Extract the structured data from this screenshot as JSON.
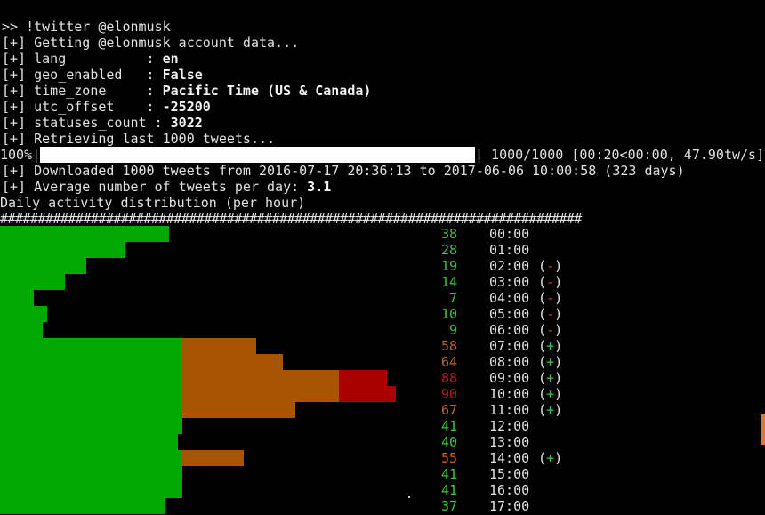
{
  "lines": [
    ">> !twitter @elonmusk",
    "[+] Getting @elonmusk account data..."
  ],
  "fields": [
    {
      "prefix": "[+] lang          : ",
      "value": "en"
    },
    {
      "prefix": "[+] geo_enabled   : ",
      "value": "False"
    },
    {
      "prefix": "[+] time_zone     : ",
      "value": "Pacific Time (US & Canada)"
    },
    {
      "prefix": "[+] utc_offset    : ",
      "value": "-25200"
    },
    {
      "prefix": "[+] statuses_count : ",
      "value": "3022"
    }
  ],
  "retrieving": "[+] Retrieving last 1000 tweets...",
  "progress": {
    "percent_text": "100%|",
    "fraction": 1.0,
    "suffix": "| 1000/1000 [00:20<00:00, 47.90tw/s]"
  },
  "downloaded": "[+] Downloaded 1000 tweets from 2016-07-17 20:36:13 to 2017-06-06 10:00:58 (323 days)",
  "average": {
    "prefix": "[+] Average number of tweets per day: ",
    "value": "3.1"
  },
  "dist_title": "Daily activity distribution (per hour)",
  "separator": "#############################################################################",
  "colors": {
    "green": "#00a800",
    "orange": "#a85400",
    "red": "#a80000",
    "bright_green": "#3fc43f"
  },
  "activity": [
    {
      "count": "38",
      "hour": "00:00",
      "mark": "",
      "level": "green"
    },
    {
      "count": "28",
      "hour": "01:00",
      "mark": "",
      "level": "green"
    },
    {
      "count": "19",
      "hour": "02:00",
      "mark": "-",
      "level": "green"
    },
    {
      "count": "14",
      "hour": "03:00",
      "mark": "-",
      "level": "green"
    },
    {
      "count": "7",
      "hour": "04:00",
      "mark": "-",
      "level": "green"
    },
    {
      "count": "10",
      "hour": "05:00",
      "mark": "-",
      "level": "green"
    },
    {
      "count": "9",
      "hour": "06:00",
      "mark": "-",
      "level": "green"
    },
    {
      "count": "58",
      "hour": "07:00",
      "mark": "+",
      "level": "orange"
    },
    {
      "count": "64",
      "hour": "08:00",
      "mark": "+",
      "level": "orange"
    },
    {
      "count": "88",
      "hour": "09:00",
      "mark": "+",
      "level": "red"
    },
    {
      "count": "90",
      "hour": "10:00",
      "mark": "+",
      "level": "red"
    },
    {
      "count": "67",
      "hour": "11:00",
      "mark": "+",
      "level": "orange"
    },
    {
      "count": "41",
      "hour": "12:00",
      "mark": "",
      "level": "green"
    },
    {
      "count": "40",
      "hour": "13:00",
      "mark": "",
      "level": "green"
    },
    {
      "count": "55",
      "hour": "14:00",
      "mark": "+",
      "level": "orange"
    },
    {
      "count": "41",
      "hour": "15:00",
      "mark": "",
      "level": "green"
    },
    {
      "count": "41",
      "hour": "16:00",
      "mark": "",
      "level": "green"
    },
    {
      "count": "37",
      "hour": "17:00",
      "mark": "",
      "level": "green"
    }
  ]
}
